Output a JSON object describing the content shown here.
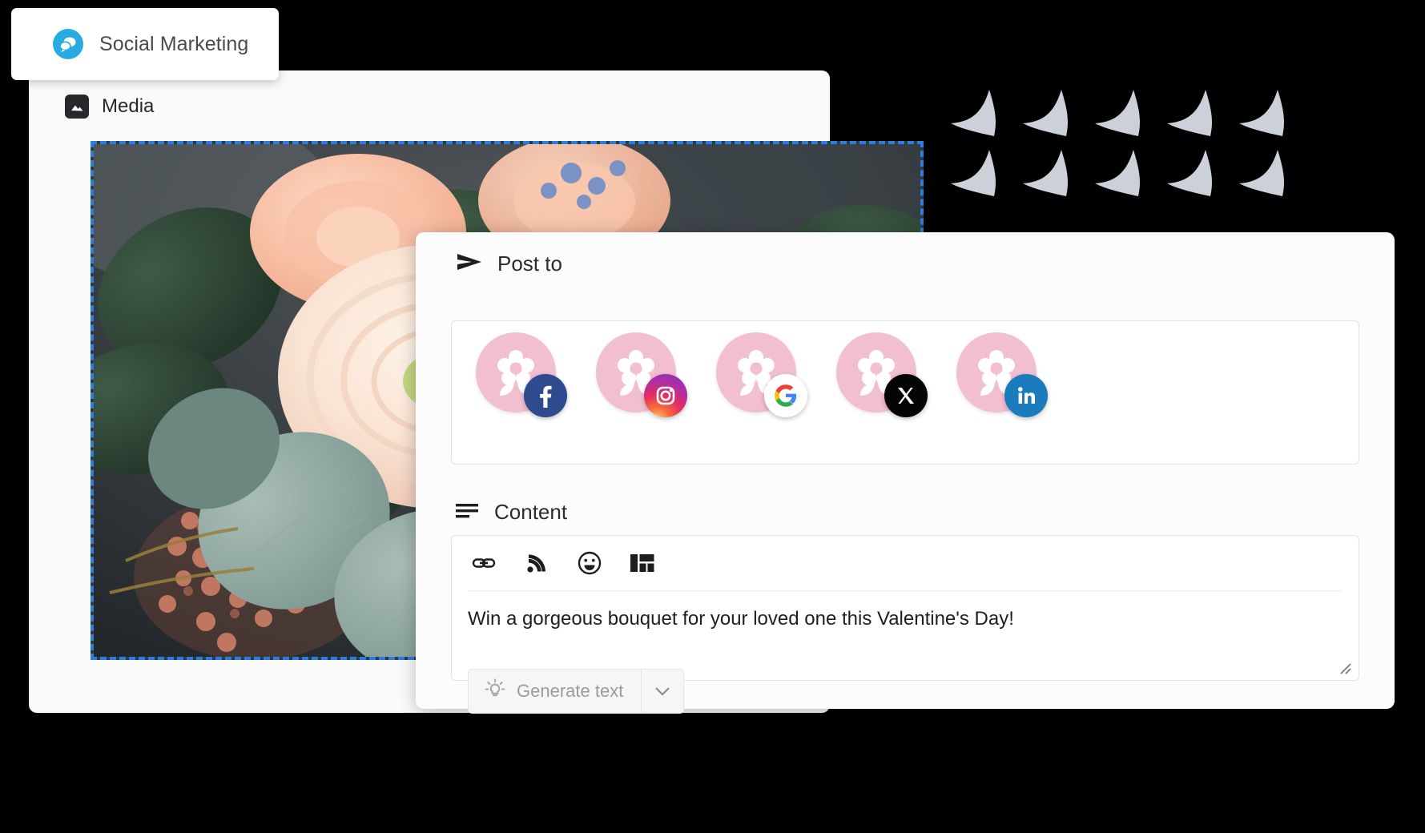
{
  "brand": {
    "title": "Social Marketing",
    "logo_icon": "chat-bubbles-icon",
    "logo_color": "#29abe2"
  },
  "media_panel": {
    "label": "Media",
    "icon": "image-icon",
    "selection_border_color": "#2a7de1",
    "image_alt": "Close-up photograph of a flower bouquet with cream ranunculus, peach roses, eucalyptus leaves and pink berries"
  },
  "composer": {
    "post_to": {
      "title": "Post to",
      "icon": "send-arrow-icon",
      "accounts": [
        {
          "name": "flower-shop-facebook",
          "avatar_icon": "flower-logo",
          "platform": "facebook",
          "badge_glyph": "f"
        },
        {
          "name": "flower-shop-instagram",
          "avatar_icon": "flower-logo",
          "platform": "instagram",
          "badge_glyph": ""
        },
        {
          "name": "flower-shop-google",
          "avatar_icon": "flower-logo",
          "platform": "google",
          "badge_glyph": "G"
        },
        {
          "name": "flower-shop-x",
          "avatar_icon": "flower-logo",
          "platform": "x",
          "badge_glyph": "X"
        },
        {
          "name": "flower-shop-linkedin",
          "avatar_icon": "flower-logo",
          "platform": "linkedin",
          "badge_glyph": "in"
        }
      ],
      "avatar_color": "#f1bfd0"
    },
    "content": {
      "title": "Content",
      "icon": "align-lines-icon",
      "toolbar": [
        {
          "name": "insert-link-button",
          "icon": "link-icon"
        },
        {
          "name": "insert-feed-button",
          "icon": "rss-icon"
        },
        {
          "name": "insert-emoji-button",
          "icon": "emoji-icon"
        },
        {
          "name": "insert-template-button",
          "icon": "layout-grid-icon"
        }
      ],
      "text": "Win a gorgeous bouquet for your loved one this Valentine's Day!",
      "generate_button": {
        "label": "Generate text",
        "icon": "lightbulb-icon",
        "caret_icon": "chevron-down-icon",
        "disabled": true
      },
      "resize_handle": "resize-grip-icon"
    }
  },
  "decoration": {
    "shape_name": "concave-triangle-shape",
    "color": "#ccd1d9",
    "columns": 5,
    "rows": 2
  }
}
